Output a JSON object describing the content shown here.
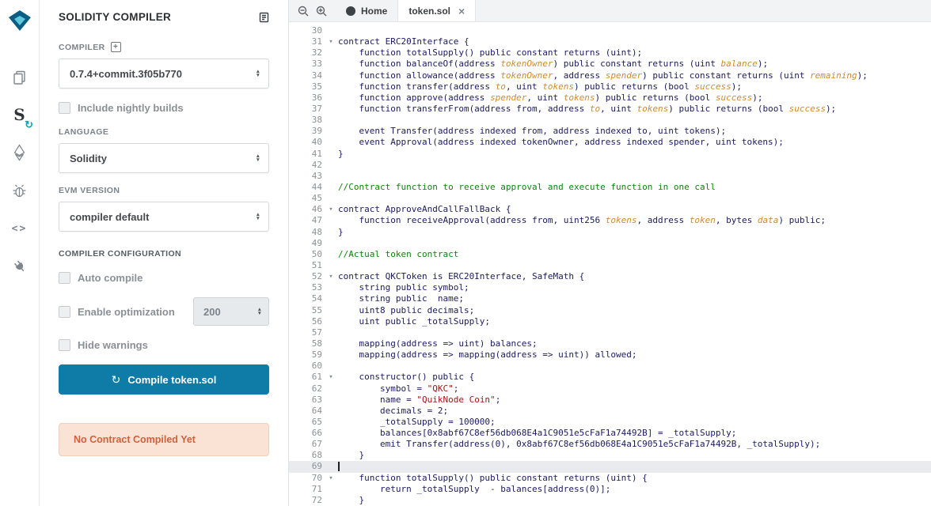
{
  "colors": {
    "accent": "#0e7ca6",
    "warning_bg": "#fae3d5",
    "warning_text": "#d0613a"
  },
  "icons": {
    "close": "×",
    "refresh": "↻",
    "add": "+",
    "fold_arrow": "▾",
    "select_up": "▲",
    "select_down": "▼",
    "brackets": "<>",
    "compiler_s": "S"
  },
  "activity_bar": {
    "items": [
      "file-explorer",
      "solidity-compiler",
      "deploy-and-run",
      "debugger",
      "source-verifier",
      "plugin-manager"
    ],
    "active": "solidity-compiler"
  },
  "panel": {
    "title": "SOLIDITY COMPILER",
    "compiler": {
      "label": "COMPILER",
      "version": "0.7.4+commit.3f05b770",
      "nightly_label": "Include nightly builds"
    },
    "language": {
      "label": "LANGUAGE",
      "value": "Solidity"
    },
    "evm": {
      "label": "EVM VERSION",
      "value": "compiler default"
    },
    "config": {
      "label": "COMPILER CONFIGURATION",
      "auto_compile_label": "Auto compile",
      "optimization_label": "Enable optimization",
      "runs_value": "200",
      "hide_warnings_label": "Hide warnings"
    },
    "compile_button_label": "Compile token.sol",
    "status_message": "No Contract Compiled Yet"
  },
  "editor": {
    "tabs": [
      {
        "label": "Home",
        "active": false
      },
      {
        "label": "token.sol",
        "active": true
      }
    ],
    "current_line": 69,
    "lines": [
      {
        "n": 30,
        "tokens": []
      },
      {
        "n": 31,
        "fold": true,
        "tokens": [
          [
            "contract ERC20Interface {",
            "d"
          ]
        ]
      },
      {
        "n": 32,
        "tokens": [
          [
            "    function totalSupply() public constant returns (uint);",
            "d"
          ]
        ]
      },
      {
        "n": 33,
        "tokens": [
          [
            "    function balanceOf(address ",
            "d"
          ],
          [
            "tokenOwner",
            "o"
          ],
          [
            ") public constant returns (uint ",
            "d"
          ],
          [
            "balance",
            "o"
          ],
          [
            ");",
            "d"
          ]
        ]
      },
      {
        "n": 34,
        "tokens": [
          [
            "    function allowance(address ",
            "d"
          ],
          [
            "tokenOwner",
            "o"
          ],
          [
            ", address ",
            "d"
          ],
          [
            "spender",
            "o"
          ],
          [
            ") public constant returns (uint ",
            "d"
          ],
          [
            "remaining",
            "o"
          ],
          [
            ");",
            "d"
          ]
        ]
      },
      {
        "n": 35,
        "tokens": [
          [
            "    function transfer(address ",
            "d"
          ],
          [
            "to",
            "o"
          ],
          [
            ", uint ",
            "d"
          ],
          [
            "tokens",
            "o"
          ],
          [
            ") public returns (bool ",
            "d"
          ],
          [
            "success",
            "o"
          ],
          [
            ");",
            "d"
          ]
        ]
      },
      {
        "n": 36,
        "tokens": [
          [
            "    function approve(address ",
            "d"
          ],
          [
            "spender",
            "o"
          ],
          [
            ", uint ",
            "d"
          ],
          [
            "tokens",
            "o"
          ],
          [
            ") public returns (bool ",
            "d"
          ],
          [
            "success",
            "o"
          ],
          [
            ");",
            "d"
          ]
        ]
      },
      {
        "n": 37,
        "tokens": [
          [
            "    function transferFrom(address from, address ",
            "d"
          ],
          [
            "to",
            "o"
          ],
          [
            ", uint ",
            "d"
          ],
          [
            "tokens",
            "o"
          ],
          [
            ") public returns (bool ",
            "d"
          ],
          [
            "success",
            "o"
          ],
          [
            ");",
            "d"
          ]
        ]
      },
      {
        "n": 38,
        "tokens": []
      },
      {
        "n": 39,
        "tokens": [
          [
            "    event Transfer(address indexed from, address indexed to, uint tokens);",
            "d"
          ]
        ]
      },
      {
        "n": 40,
        "tokens": [
          [
            "    event Approval(address indexed tokenOwner, address indexed spender, uint tokens);",
            "d"
          ]
        ]
      },
      {
        "n": 41,
        "tokens": [
          [
            "}",
            "d"
          ]
        ]
      },
      {
        "n": 42,
        "tokens": []
      },
      {
        "n": 43,
        "tokens": []
      },
      {
        "n": 44,
        "tokens": [
          [
            "//Contract function to receive approval and execute function in one call",
            "g"
          ]
        ]
      },
      {
        "n": 45,
        "tokens": []
      },
      {
        "n": 46,
        "fold": true,
        "tokens": [
          [
            "contract ApproveAndCallFallBack {",
            "d"
          ]
        ]
      },
      {
        "n": 47,
        "tokens": [
          [
            "    function receiveApproval(address from, uint256 ",
            "d"
          ],
          [
            "tokens",
            "o"
          ],
          [
            ", address ",
            "d"
          ],
          [
            "token",
            "o"
          ],
          [
            ", bytes ",
            "d"
          ],
          [
            "data",
            "o"
          ],
          [
            ") public;",
            "d"
          ]
        ]
      },
      {
        "n": 48,
        "tokens": [
          [
            "}",
            "d"
          ]
        ]
      },
      {
        "n": 49,
        "tokens": []
      },
      {
        "n": 50,
        "tokens": [
          [
            "//Actual token contract",
            "g"
          ]
        ]
      },
      {
        "n": 51,
        "tokens": []
      },
      {
        "n": 52,
        "fold": true,
        "tokens": [
          [
            "contract QKCToken is ERC20Interface, SafeMath {",
            "d"
          ]
        ]
      },
      {
        "n": 53,
        "tokens": [
          [
            "    string public symbol;",
            "d"
          ]
        ]
      },
      {
        "n": 54,
        "tokens": [
          [
            "    string public  name;",
            "d"
          ]
        ]
      },
      {
        "n": 55,
        "tokens": [
          [
            "    uint8 public decimals;",
            "d"
          ]
        ]
      },
      {
        "n": 56,
        "tokens": [
          [
            "    uint public _totalSupply;",
            "d"
          ]
        ]
      },
      {
        "n": 57,
        "tokens": []
      },
      {
        "n": 58,
        "tokens": [
          [
            "    mapping(address => uint) balances;",
            "d"
          ]
        ]
      },
      {
        "n": 59,
        "tokens": [
          [
            "    mapping(address => mapping(address => uint)) allowed;",
            "d"
          ]
        ]
      },
      {
        "n": 60,
        "tokens": []
      },
      {
        "n": 61,
        "fold": true,
        "tokens": [
          [
            "    constructor() public {",
            "d"
          ]
        ]
      },
      {
        "n": 62,
        "tokens": [
          [
            "        symbol = ",
            "d"
          ],
          [
            "\"QKC\"",
            "s"
          ],
          [
            ";",
            "d"
          ]
        ]
      },
      {
        "n": 63,
        "tokens": [
          [
            "        name = ",
            "d"
          ],
          [
            "\"QuikNode Coin\"",
            "s"
          ],
          [
            ";",
            "d"
          ]
        ]
      },
      {
        "n": 64,
        "tokens": [
          [
            "        decimals = 2;",
            "d"
          ]
        ]
      },
      {
        "n": 65,
        "tokens": [
          [
            "        _totalSupply = 100000;",
            "d"
          ]
        ]
      },
      {
        "n": 66,
        "tokens": [
          [
            "        balances[0x8abf67C8ef56db068E4a1C9051e5cFaF1a74492B] = _totalSupply;",
            "d"
          ]
        ]
      },
      {
        "n": 67,
        "tokens": [
          [
            "        emit Transfer(address(0), 0x8abf67C8ef56db068E4a1C9051e5cFaF1a74492B, _totalSupply);",
            "d"
          ]
        ]
      },
      {
        "n": 68,
        "tokens": [
          [
            "    }",
            "d"
          ]
        ]
      },
      {
        "n": 69,
        "tokens": []
      },
      {
        "n": 70,
        "fold": true,
        "tokens": [
          [
            "    function totalSupply() public constant returns (uint) {",
            "d"
          ]
        ]
      },
      {
        "n": 71,
        "tokens": [
          [
            "        return _totalSupply  - balances[address(0)];",
            "d"
          ]
        ]
      },
      {
        "n": 72,
        "tokens": [
          [
            "    }",
            "d"
          ]
        ]
      }
    ]
  }
}
